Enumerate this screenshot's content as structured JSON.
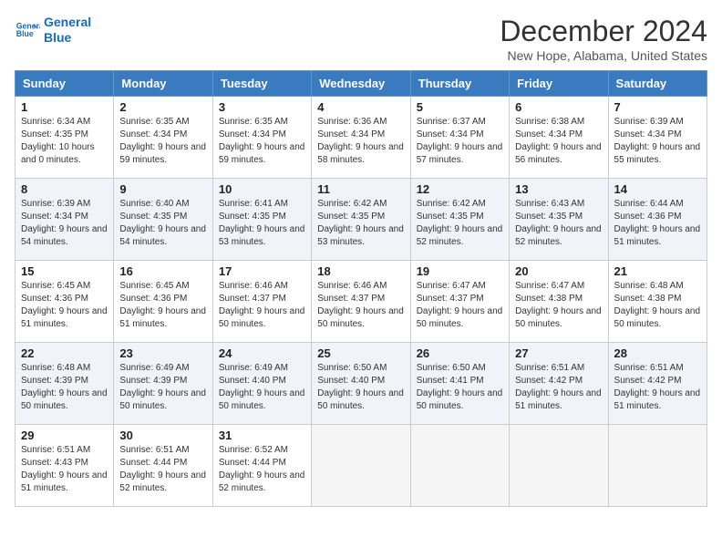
{
  "header": {
    "logo_line1": "General",
    "logo_line2": "Blue",
    "month_title": "December 2024",
    "location": "New Hope, Alabama, United States"
  },
  "weekdays": [
    "Sunday",
    "Monday",
    "Tuesday",
    "Wednesday",
    "Thursday",
    "Friday",
    "Saturday"
  ],
  "weeks": [
    [
      {
        "day": "1",
        "sunrise": "6:34 AM",
        "sunset": "4:35 PM",
        "daylight": "10 hours and 0 minutes."
      },
      {
        "day": "2",
        "sunrise": "6:35 AM",
        "sunset": "4:34 PM",
        "daylight": "9 hours and 59 minutes."
      },
      {
        "day": "3",
        "sunrise": "6:35 AM",
        "sunset": "4:34 PM",
        "daylight": "9 hours and 59 minutes."
      },
      {
        "day": "4",
        "sunrise": "6:36 AM",
        "sunset": "4:34 PM",
        "daylight": "9 hours and 58 minutes."
      },
      {
        "day": "5",
        "sunrise": "6:37 AM",
        "sunset": "4:34 PM",
        "daylight": "9 hours and 57 minutes."
      },
      {
        "day": "6",
        "sunrise": "6:38 AM",
        "sunset": "4:34 PM",
        "daylight": "9 hours and 56 minutes."
      },
      {
        "day": "7",
        "sunrise": "6:39 AM",
        "sunset": "4:34 PM",
        "daylight": "9 hours and 55 minutes."
      }
    ],
    [
      {
        "day": "8",
        "sunrise": "6:39 AM",
        "sunset": "4:34 PM",
        "daylight": "9 hours and 54 minutes."
      },
      {
        "day": "9",
        "sunrise": "6:40 AM",
        "sunset": "4:35 PM",
        "daylight": "9 hours and 54 minutes."
      },
      {
        "day": "10",
        "sunrise": "6:41 AM",
        "sunset": "4:35 PM",
        "daylight": "9 hours and 53 minutes."
      },
      {
        "day": "11",
        "sunrise": "6:42 AM",
        "sunset": "4:35 PM",
        "daylight": "9 hours and 53 minutes."
      },
      {
        "day": "12",
        "sunrise": "6:42 AM",
        "sunset": "4:35 PM",
        "daylight": "9 hours and 52 minutes."
      },
      {
        "day": "13",
        "sunrise": "6:43 AM",
        "sunset": "4:35 PM",
        "daylight": "9 hours and 52 minutes."
      },
      {
        "day": "14",
        "sunrise": "6:44 AM",
        "sunset": "4:36 PM",
        "daylight": "9 hours and 51 minutes."
      }
    ],
    [
      {
        "day": "15",
        "sunrise": "6:45 AM",
        "sunset": "4:36 PM",
        "daylight": "9 hours and 51 minutes."
      },
      {
        "day": "16",
        "sunrise": "6:45 AM",
        "sunset": "4:36 PM",
        "daylight": "9 hours and 51 minutes."
      },
      {
        "day": "17",
        "sunrise": "6:46 AM",
        "sunset": "4:37 PM",
        "daylight": "9 hours and 50 minutes."
      },
      {
        "day": "18",
        "sunrise": "6:46 AM",
        "sunset": "4:37 PM",
        "daylight": "9 hours and 50 minutes."
      },
      {
        "day": "19",
        "sunrise": "6:47 AM",
        "sunset": "4:37 PM",
        "daylight": "9 hours and 50 minutes."
      },
      {
        "day": "20",
        "sunrise": "6:47 AM",
        "sunset": "4:38 PM",
        "daylight": "9 hours and 50 minutes."
      },
      {
        "day": "21",
        "sunrise": "6:48 AM",
        "sunset": "4:38 PM",
        "daylight": "9 hours and 50 minutes."
      }
    ],
    [
      {
        "day": "22",
        "sunrise": "6:48 AM",
        "sunset": "4:39 PM",
        "daylight": "9 hours and 50 minutes."
      },
      {
        "day": "23",
        "sunrise": "6:49 AM",
        "sunset": "4:39 PM",
        "daylight": "9 hours and 50 minutes."
      },
      {
        "day": "24",
        "sunrise": "6:49 AM",
        "sunset": "4:40 PM",
        "daylight": "9 hours and 50 minutes."
      },
      {
        "day": "25",
        "sunrise": "6:50 AM",
        "sunset": "4:40 PM",
        "daylight": "9 hours and 50 minutes."
      },
      {
        "day": "26",
        "sunrise": "6:50 AM",
        "sunset": "4:41 PM",
        "daylight": "9 hours and 50 minutes."
      },
      {
        "day": "27",
        "sunrise": "6:51 AM",
        "sunset": "4:42 PM",
        "daylight": "9 hours and 51 minutes."
      },
      {
        "day": "28",
        "sunrise": "6:51 AM",
        "sunset": "4:42 PM",
        "daylight": "9 hours and 51 minutes."
      }
    ],
    [
      {
        "day": "29",
        "sunrise": "6:51 AM",
        "sunset": "4:43 PM",
        "daylight": "9 hours and 51 minutes."
      },
      {
        "day": "30",
        "sunrise": "6:51 AM",
        "sunset": "4:44 PM",
        "daylight": "9 hours and 52 minutes."
      },
      {
        "day": "31",
        "sunrise": "6:52 AM",
        "sunset": "4:44 PM",
        "daylight": "9 hours and 52 minutes."
      },
      null,
      null,
      null,
      null
    ]
  ],
  "labels": {
    "sunrise": "Sunrise:",
    "sunset": "Sunset:",
    "daylight": "Daylight:"
  }
}
